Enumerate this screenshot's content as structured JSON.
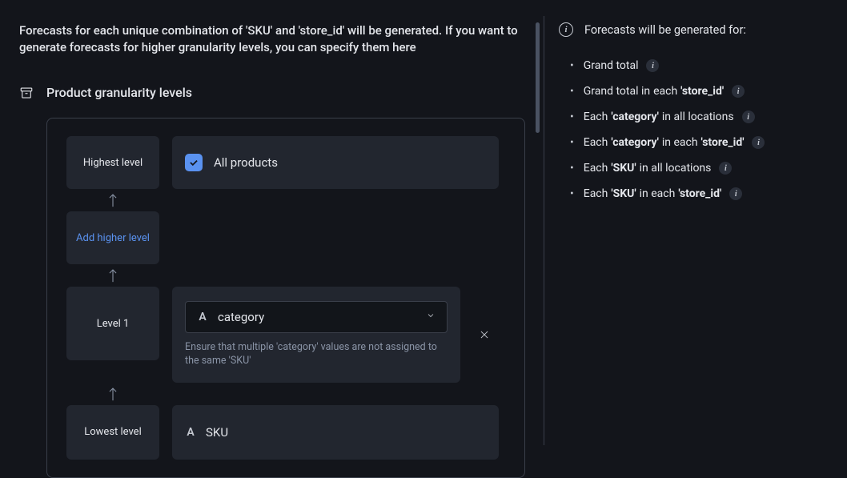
{
  "description": "Forecasts for each unique combination of 'SKU' and 'store_id' will be generated. If you want to generate forecasts for higher granularity levels, you can specify them here",
  "section_title": "Product granularity levels",
  "levels": {
    "highest": {
      "label": "Highest level",
      "content": "All products",
      "checked": true
    },
    "add_higher_link": "Add higher level",
    "level1": {
      "label": "Level 1",
      "value": "category",
      "hint": "Ensure that multiple 'category' values are not assigned to the same 'SKU'"
    },
    "lowest": {
      "label": "Lowest level",
      "value": "SKU"
    }
  },
  "right": {
    "title": "Forecasts will be generated for:",
    "items": [
      {
        "parts": [
          {
            "t": "Grand total"
          }
        ]
      },
      {
        "parts": [
          {
            "t": "Grand total in"
          },
          {
            "t": "each"
          },
          {
            "t": "'store_id'",
            "b": true
          }
        ]
      },
      {
        "parts": [
          {
            "t": "Each"
          },
          {
            "t": "'category'",
            "b": true
          },
          {
            "t": "in all locations"
          }
        ]
      },
      {
        "parts": [
          {
            "t": "Each"
          },
          {
            "t": "'category'",
            "b": true
          },
          {
            "t": "in each"
          },
          {
            "t": "'store_id'",
            "b": true
          }
        ]
      },
      {
        "parts": [
          {
            "t": "Each"
          },
          {
            "t": "'SKU'",
            "b": true
          },
          {
            "t": "in all locations"
          }
        ]
      },
      {
        "parts": [
          {
            "t": "Each"
          },
          {
            "t": "'SKU'",
            "b": true
          },
          {
            "t": "in each"
          },
          {
            "t": "'store_id'",
            "b": true
          }
        ]
      }
    ]
  }
}
